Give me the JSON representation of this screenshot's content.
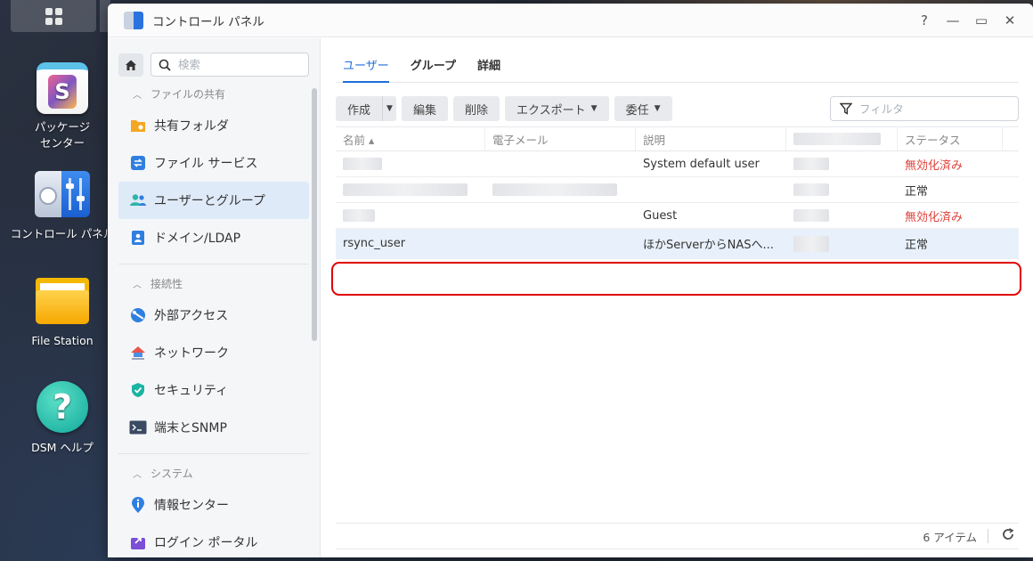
{
  "desktop": {
    "icons": [
      {
        "label_line1": "パッケージ",
        "label_line2": "センター"
      },
      {
        "label_line1": "コントロール パネル",
        "label_line2": ""
      },
      {
        "label_line1": "File Station",
        "label_line2": ""
      },
      {
        "label_line1": "DSM ヘルプ",
        "label_line2": ""
      }
    ]
  },
  "window": {
    "title": "コントロール パネル",
    "controls": {
      "help": "?",
      "minimize": "—",
      "maximize": "▭",
      "close": "✕"
    }
  },
  "sidebar": {
    "search_placeholder": "検索",
    "sections": [
      {
        "title": "ファイルの共有",
        "items": [
          {
            "label": "共有フォルダ",
            "icon": "shared-folder-icon"
          },
          {
            "label": "ファイル サービス",
            "icon": "file-services-icon"
          },
          {
            "label": "ユーザーとグループ",
            "icon": "users-groups-icon",
            "active": true
          },
          {
            "label": "ドメイン/LDAP",
            "icon": "domain-ldap-icon"
          }
        ]
      },
      {
        "title": "接続性",
        "items": [
          {
            "label": "外部アクセス",
            "icon": "external-access-icon"
          },
          {
            "label": "ネットワーク",
            "icon": "network-icon"
          },
          {
            "label": "セキュリティ",
            "icon": "security-icon"
          },
          {
            "label": "端末とSNMP",
            "icon": "terminal-icon"
          }
        ]
      },
      {
        "title": "システム",
        "items": [
          {
            "label": "情報センター",
            "icon": "info-center-icon"
          },
          {
            "label": "ログイン ポータル",
            "icon": "login-portal-icon"
          }
        ]
      }
    ]
  },
  "main": {
    "tabs": [
      {
        "label": "ユーザー",
        "active": true
      },
      {
        "label": "グループ"
      },
      {
        "label": "詳細"
      }
    ],
    "toolbar": {
      "create": "作成",
      "edit": "編集",
      "delete": "削除",
      "export": "エクスポート",
      "delegate": "委任",
      "filter_placeholder": "フィルタ"
    },
    "table": {
      "columns": [
        "名前 ▴",
        "電子メール",
        "説明",
        "",
        "ステータス"
      ],
      "rows": [
        {
          "name": "",
          "email": "",
          "description": "System default user",
          "status": "無効化済み",
          "status_color": "red"
        },
        {
          "name": "",
          "email": "",
          "description": "",
          "status": "正常",
          "status_color": "normal"
        },
        {
          "name": "",
          "email": "",
          "description": "Guest",
          "status": "無効化済み",
          "status_color": "red"
        },
        {
          "name": "rsync_user",
          "email": "",
          "description": "ほかServerからNASへ...",
          "status": "正常",
          "status_color": "normal",
          "selected": true
        }
      ]
    },
    "footer": {
      "count": "6 アイテム"
    }
  },
  "colors": {
    "accent": "#1e6fd9",
    "disabled_status": "#e2423b",
    "highlight": "#e00000",
    "selected_row": "#e8f1fb"
  }
}
